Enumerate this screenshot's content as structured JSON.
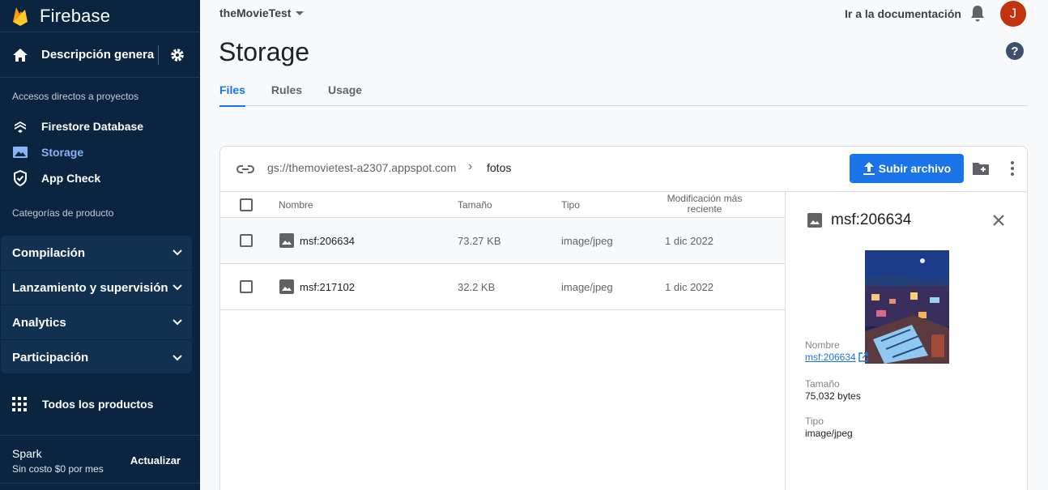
{
  "colors": {
    "sidebar_bg": "#0b2540",
    "accent": "#1a73e8",
    "avatar_bg": "#c3320f",
    "active_nav": "#8ab4f8"
  },
  "sidebar": {
    "brand": "Firebase",
    "overview_label": "Descripción general ...",
    "shortcuts_heading": "Accesos directos a proyectos",
    "shortcuts": [
      {
        "label": "Firestore Database",
        "icon": "firestore-icon",
        "active": false
      },
      {
        "label": "Storage",
        "icon": "storage-icon",
        "active": true
      },
      {
        "label": "App Check",
        "icon": "app-check-icon",
        "active": false
      }
    ],
    "categories_heading": "Categorías de producto",
    "categories": [
      {
        "label": "Compilación"
      },
      {
        "label": "Lanzamiento y supervisión"
      },
      {
        "label": "Analytics"
      },
      {
        "label": "Participación"
      }
    ],
    "all_products": "Todos los productos",
    "plan_name": "Spark",
    "plan_cost": "Sin costo $0 por mes",
    "upgrade": "Actualizar"
  },
  "header": {
    "project": "theMovieTest",
    "docs_link": "Ir a la documentación",
    "avatar_letter": "J",
    "page_title": "Storage",
    "help_glyph": "?"
  },
  "tabs": [
    {
      "label": "Files",
      "active": true
    },
    {
      "label": "Rules",
      "active": false
    },
    {
      "label": "Usage",
      "active": false
    }
  ],
  "browser": {
    "bucket": "gs://themovietest-a2307.appspot.com",
    "separator": "›",
    "folder": "fotos",
    "upload_label": "Subir archivo",
    "columns": {
      "name": "Nombre",
      "size": "Tamaño",
      "type": "Tipo",
      "modified": "Modificación más reciente"
    },
    "rows": [
      {
        "name": "msf:206634",
        "size": "73.27 KB",
        "type": "image/jpeg",
        "modified": "1 dic 2022"
      },
      {
        "name": "msf:217102",
        "size": "32.2 KB",
        "type": "image/jpeg",
        "modified": "1 dic 2022"
      }
    ]
  },
  "detail": {
    "title": "msf:206634",
    "name_label": "Nombre",
    "name_value": "msf:206634",
    "size_label": "Tamaño",
    "size_value": "75,032 bytes",
    "type_label": "Tipo",
    "type_value": "image/jpeg"
  }
}
